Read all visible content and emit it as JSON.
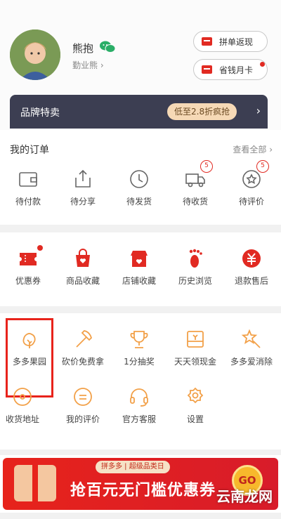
{
  "header": {
    "username": "熊抱",
    "subline": "勤业熊",
    "pills": [
      {
        "label": "拼单返现"
      },
      {
        "label": "省钱月卡"
      }
    ]
  },
  "brand": {
    "title": "品牌特卖",
    "promo": "低至2.8折疯抢",
    "arrow": "›"
  },
  "orders": {
    "title": "我的订单",
    "more": "查看全部 ›",
    "items": [
      {
        "label": "待付款",
        "icon": "wallet-icon"
      },
      {
        "label": "待分享",
        "icon": "share-icon"
      },
      {
        "label": "待发货",
        "icon": "clock-icon"
      },
      {
        "label": "待收货",
        "icon": "truck-icon",
        "badge": "5"
      },
      {
        "label": "待评价",
        "icon": "review-icon",
        "badge": "5"
      }
    ]
  },
  "services": {
    "items": [
      {
        "label": "优惠券",
        "icon": "coupon-icon"
      },
      {
        "label": "商品收藏",
        "icon": "bag-heart-icon"
      },
      {
        "label": "店铺收藏",
        "icon": "store-icon"
      },
      {
        "label": "历史浏览",
        "icon": "footprint-icon"
      },
      {
        "label": "退款售后",
        "icon": "refund-icon"
      }
    ]
  },
  "tools": {
    "items": [
      {
        "label": "多多果园",
        "icon": "tree-icon"
      },
      {
        "label": "砍价免费拿",
        "icon": "axe-icon"
      },
      {
        "label": "1分抽奖",
        "icon": "trophy-icon"
      },
      {
        "label": "天天领现金",
        "icon": "cash-box-icon"
      },
      {
        "label": "多多爱消除",
        "icon": "star-wand-icon"
      },
      {
        "label": "收货地址",
        "icon": "location-icon"
      },
      {
        "label": "我的评价",
        "icon": "comment-icon"
      },
      {
        "label": "官方客服",
        "icon": "headset-icon"
      },
      {
        "label": "设置",
        "icon": "gear-icon"
      }
    ]
  },
  "banner": {
    "tag": "拼多多 | 超级品类日",
    "main": "抢百元无门槛优惠券",
    "go": "GO",
    "watermark": "云南龙网"
  },
  "colors": {
    "accent": "#e12a22",
    "icon_orange": "#f2a048",
    "brand_bg": "#3c3e52"
  }
}
